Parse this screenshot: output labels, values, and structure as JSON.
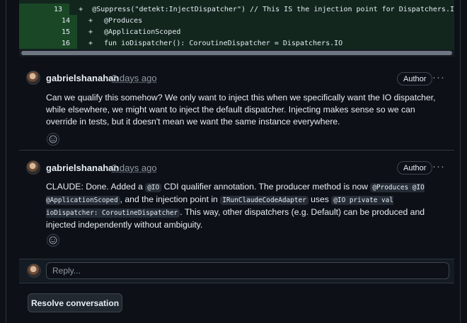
{
  "diff": {
    "lines": [
      {
        "num": "13",
        "sign": "+",
        "code": "@Suppress(\"detekt:InjectDispatcher\") // This IS the injection point for Dispatchers.I"
      },
      {
        "num": "14",
        "sign": "+",
        "code": "@Produces"
      },
      {
        "num": "15",
        "sign": "+",
        "code": "@ApplicationScoped"
      },
      {
        "num": "16",
        "sign": "+",
        "code": "fun ioDispatcher(): CoroutineDispatcher = Dispatchers.IO"
      }
    ]
  },
  "comments": [
    {
      "author": "gabrielshanahan",
      "time": "2 days ago",
      "badge": "Author",
      "kebab": "···",
      "body": "Can we qualify this somehow? We only want to inject this when we specifically want the IO dispatcher, while elsewhere, we might want to inject the default dispatcher. Injecting makes sense so we can override in tests, but it doesn't mean we want the same instance everywhere."
    },
    {
      "author": "gabrielshanahan",
      "time": "2 days ago",
      "badge": "Author",
      "kebab": "···",
      "body_parts": [
        "CLAUDE: Done. Added a ",
        "@IO",
        " CDI qualifier annotation. The producer method is now ",
        "@Produces @IO @ApplicationScoped",
        ", and the injection point in ",
        "IRunClaudeCodeAdapter",
        " uses ",
        "@IO private val ioDispatcher: CoroutineDispatcher",
        ". This way, other dispatchers (e.g. Default) can be produced and injected independently without ambiguity."
      ]
    }
  ],
  "reply": {
    "placeholder": "Reply..."
  },
  "resolve_label": "Resolve conversation",
  "icons": {
    "avatar": "user-avatar",
    "reaction": "smiley-icon",
    "kebab": "kebab-horizontal-icon"
  },
  "colors": {
    "background": "#0d1117",
    "diff_added_bg": "#12261e",
    "diff_gutter_bg": "#1a4726",
    "border": "#30363d",
    "muted_text": "#9198a1"
  }
}
